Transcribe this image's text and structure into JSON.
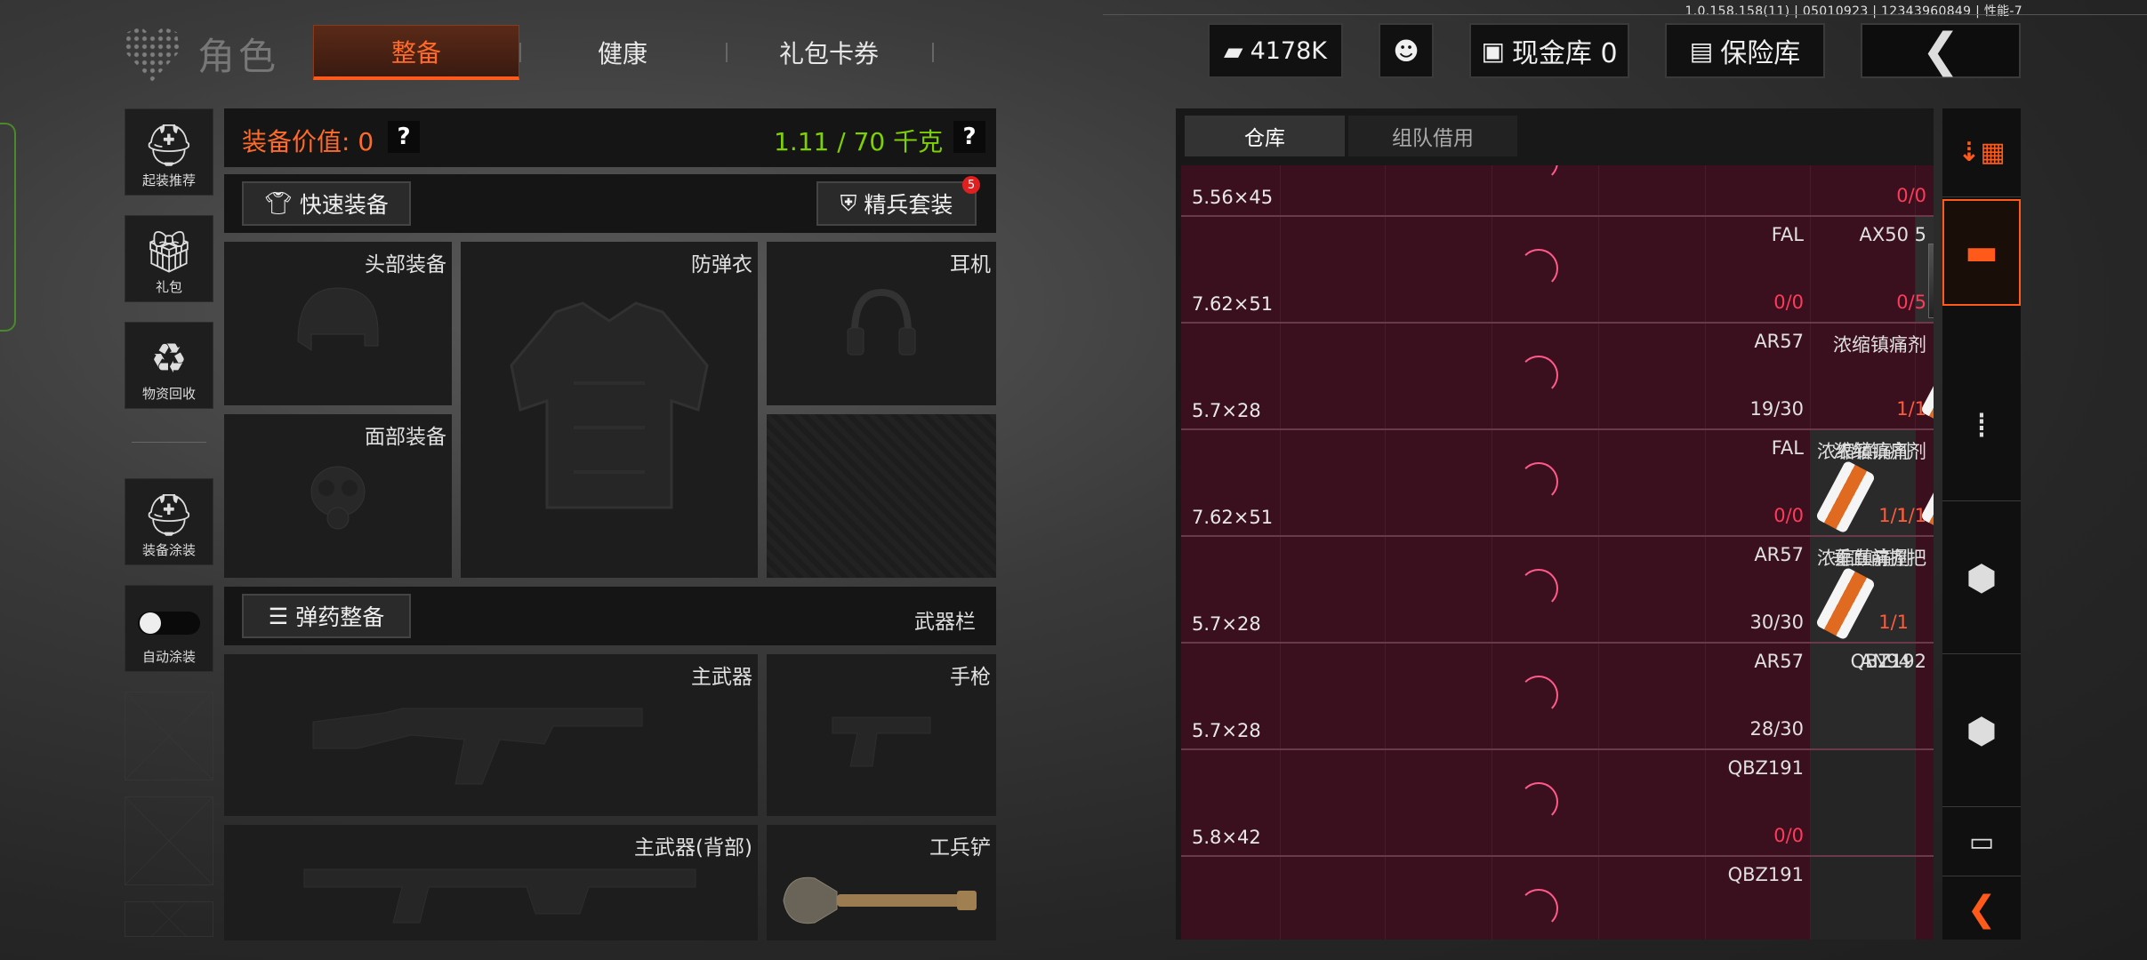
{
  "version": "1.0.158.158(11) | 05010923 | 12343960849 | 性能-7",
  "header": {
    "title": "角色",
    "tabs": [
      "整备",
      "健康",
      "礼包卡券"
    ],
    "active_tab": "整备",
    "money": "4178K",
    "cash_vault": "现金库 0",
    "insurance": "保险库"
  },
  "sidebar": {
    "items": [
      {
        "label": "起装推荐",
        "icon": "helmet-gear-icon"
      },
      {
        "label": "礼包",
        "icon": "gift-icon"
      },
      {
        "label": "物资回收",
        "icon": "recycle-icon"
      },
      {
        "label": "装备涂装",
        "icon": "paint-helmet-icon"
      },
      {
        "label": "自动涂装",
        "icon": "toggle-icon"
      }
    ]
  },
  "equipment": {
    "value_label": "装备价值: 0",
    "weight": "1.11 / 70 千克",
    "quick_equip": "快速装备",
    "elite_set": "精兵套装",
    "elite_badge": "5",
    "slots": {
      "head": "头部装备",
      "armor": "防弹衣",
      "headset": "耳机",
      "face": "面部装备"
    },
    "ammo_button": "弹药整备",
    "weapon_bar": "武器栏",
    "weapon_slots": {
      "primary": "主武器",
      "pistol": "手枪",
      "primary_back": "主武器(背部)",
      "shovel": "工兵铲"
    }
  },
  "storage": {
    "tabs": [
      "仓库",
      "组队借用"
    ],
    "active_tab": "仓库",
    "rows": [
      {
        "ammo": "5.56×45",
        "item": "",
        "count": "",
        "right": {
          "name": "",
          "count": "0/0"
        }
      },
      {
        "ammo": "7.62×51",
        "item": "FAL",
        "count": "0/0",
        "right": {
          "name": "AX50 5",
          "count": "0/5"
        }
      },
      {
        "ammo": "5.7×28",
        "item": "AR57",
        "count": "19/30",
        "right": {
          "name": "浓缩镇痛剂",
          "count": "1/1"
        }
      },
      {
        "ammo": "7.62×51",
        "item": "FAL",
        "count": "0/0",
        "mid": {
          "name": "浓缩镇痛剂",
          "count": "1/1"
        },
        "right": {
          "name": "浓缩镇痛剂",
          "count": "1/1"
        }
      },
      {
        "ammo": "5.7×28",
        "item": "AR57",
        "count": "30/30",
        "mid": {
          "name": "浓缩镇痛剂",
          "count": "1/1"
        },
        "right": {
          "name": "垂直前握把",
          "count": ""
        }
      },
      {
        "ammo": "5.7×28",
        "item": "AR57",
        "count": "28/30",
        "mid": {
          "name": "AN94",
          "count": ""
        },
        "right": {
          "name": "QBZ192",
          "count": ""
        }
      },
      {
        "ammo": "5.8×42",
        "item": "QBZ191",
        "count": "0/0",
        "right": {
          "name": "",
          "count": ""
        }
      },
      {
        "ammo": "",
        "item": "QBZ191",
        "count": "",
        "right": {
          "name": "",
          "count": ""
        }
      }
    ]
  },
  "colors": {
    "accent": "#ff5a1a",
    "weight_green": "#7fd000",
    "cell_bg": "#3a0f1e",
    "count_red": "#ff3a5a"
  }
}
